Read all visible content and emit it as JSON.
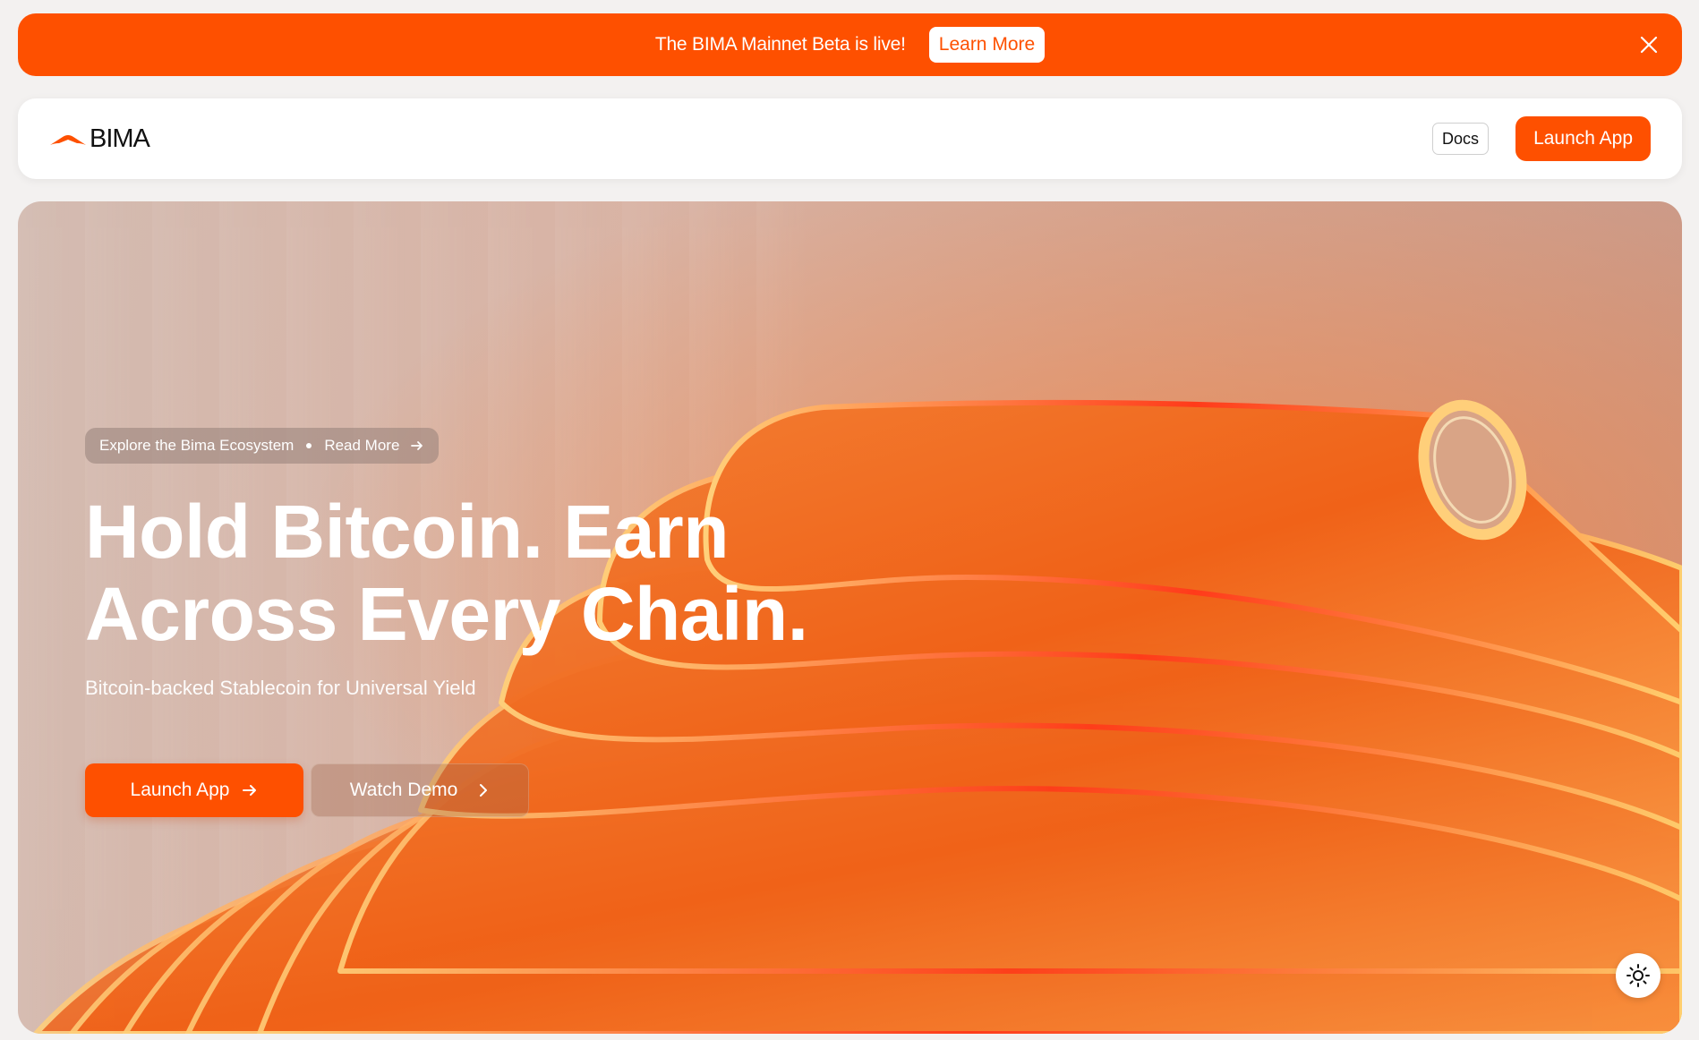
{
  "banner": {
    "message": "The BIMA Mainnet Beta is live!",
    "cta_label": "Learn More",
    "close_icon": "close-icon"
  },
  "nav": {
    "logo_text": "BIMA",
    "logo_icon": "bima-logo-icon",
    "docs_label": "Docs",
    "launch_label": "Launch App"
  },
  "hero": {
    "pill_text": "Explore the Bima Ecosystem",
    "pill_link": "Read More",
    "headline_line1": "Hold Bitcoin. Earn",
    "headline_line2": "Across Every Chain.",
    "subheadline": "Bitcoin-backed Stablecoin for Universal Yield",
    "primary_cta": "Launch App",
    "secondary_cta": "Watch Demo",
    "theme_icon": "sun-icon"
  },
  "colors": {
    "accent": "#fe5000",
    "hero_background": "#d3b3a6",
    "surface": "#ffffff"
  }
}
